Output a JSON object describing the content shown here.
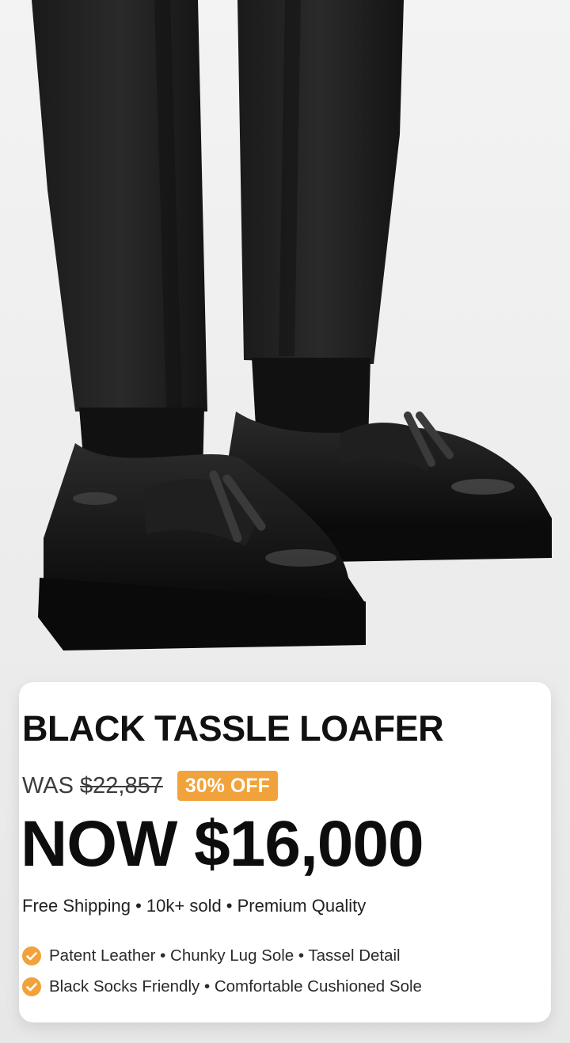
{
  "product": {
    "title": "BLACK TASSLE LOAFER",
    "was_label": "WAS",
    "was_price": "$22,857",
    "discount_badge": "30% OFF",
    "now_price": "NOW $16,000",
    "meta": "Free Shipping • 10k+ sold • Premium Quality",
    "features": [
      "Patent Leather • Chunky Lug Sole • Tassel Detail",
      "Black Socks Friendly • Comfortable Cushioned Sole"
    ]
  },
  "image": {
    "subject": "black patent tassel loafers with black trousers and black socks"
  },
  "icons": {
    "feature_bullet": "check-circle-icon"
  },
  "colors": {
    "background": "#ededed",
    "card": "#ffffff",
    "accent": "#f2a23a",
    "text": "#111111"
  }
}
